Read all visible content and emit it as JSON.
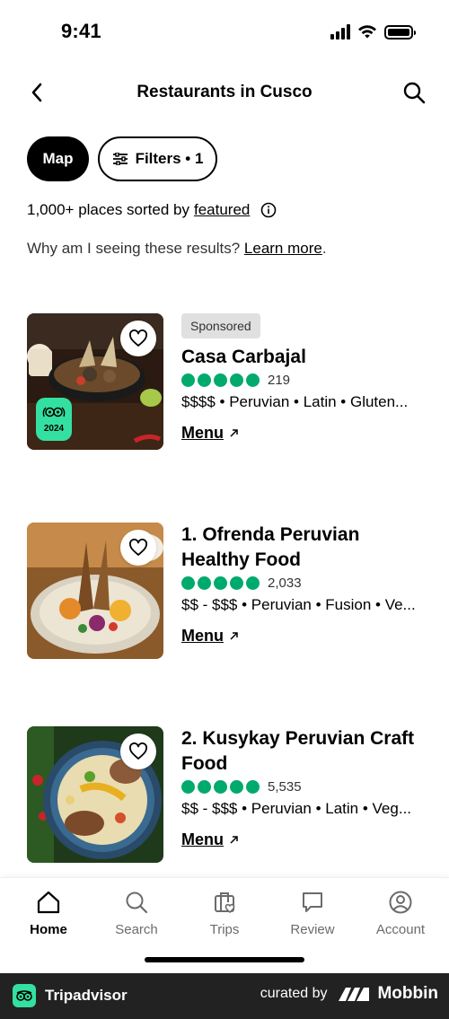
{
  "status_bar": {
    "time": "9:41"
  },
  "header": {
    "title": "Restaurants in Cusco"
  },
  "chips": {
    "map_label": "Map",
    "filters_label": "Filters • 1"
  },
  "results": {
    "count_text": "1,000+ places sorted by",
    "sort_link": "featured",
    "why_text": "Why am I seeing these results?",
    "learn_more": "Learn more",
    "period": "."
  },
  "listings": [
    {
      "badge": "Sponsored",
      "name": "Casa Carbajal",
      "rating_bubbles": 5,
      "reviews": "219",
      "details": "$$$$ • Peruvian • Latin • Gluten...",
      "menu_label": "Menu",
      "award_year": "2024"
    },
    {
      "name": "1. Ofrenda Peruvian Healthy Food",
      "rating_bubbles": 5,
      "reviews": "2,033",
      "details": "$$ - $$$ • Peruvian • Fusion • Ve...",
      "menu_label": "Menu"
    },
    {
      "name": "2. Kusykay Peruvian Craft Food",
      "rating_bubbles": 5,
      "reviews": "5,535",
      "details": "$$ - $$$ • Peruvian • Latin • Veg...",
      "menu_label": "Menu"
    }
  ],
  "bottom_nav": {
    "items": [
      {
        "label": "Home",
        "icon": "home-icon",
        "active": true
      },
      {
        "label": "Search",
        "icon": "search-icon"
      },
      {
        "label": "Trips",
        "icon": "trips-icon"
      },
      {
        "label": "Review",
        "icon": "review-icon"
      },
      {
        "label": "Account",
        "icon": "account-icon"
      }
    ]
  },
  "footer": {
    "brand": "Tripadvisor",
    "curated_by": "curated by",
    "mobbin": "Mobbin"
  },
  "colors": {
    "rating_green": "#00aa6c",
    "award_green": "#34e0a1",
    "footer_bg": "#222222"
  }
}
